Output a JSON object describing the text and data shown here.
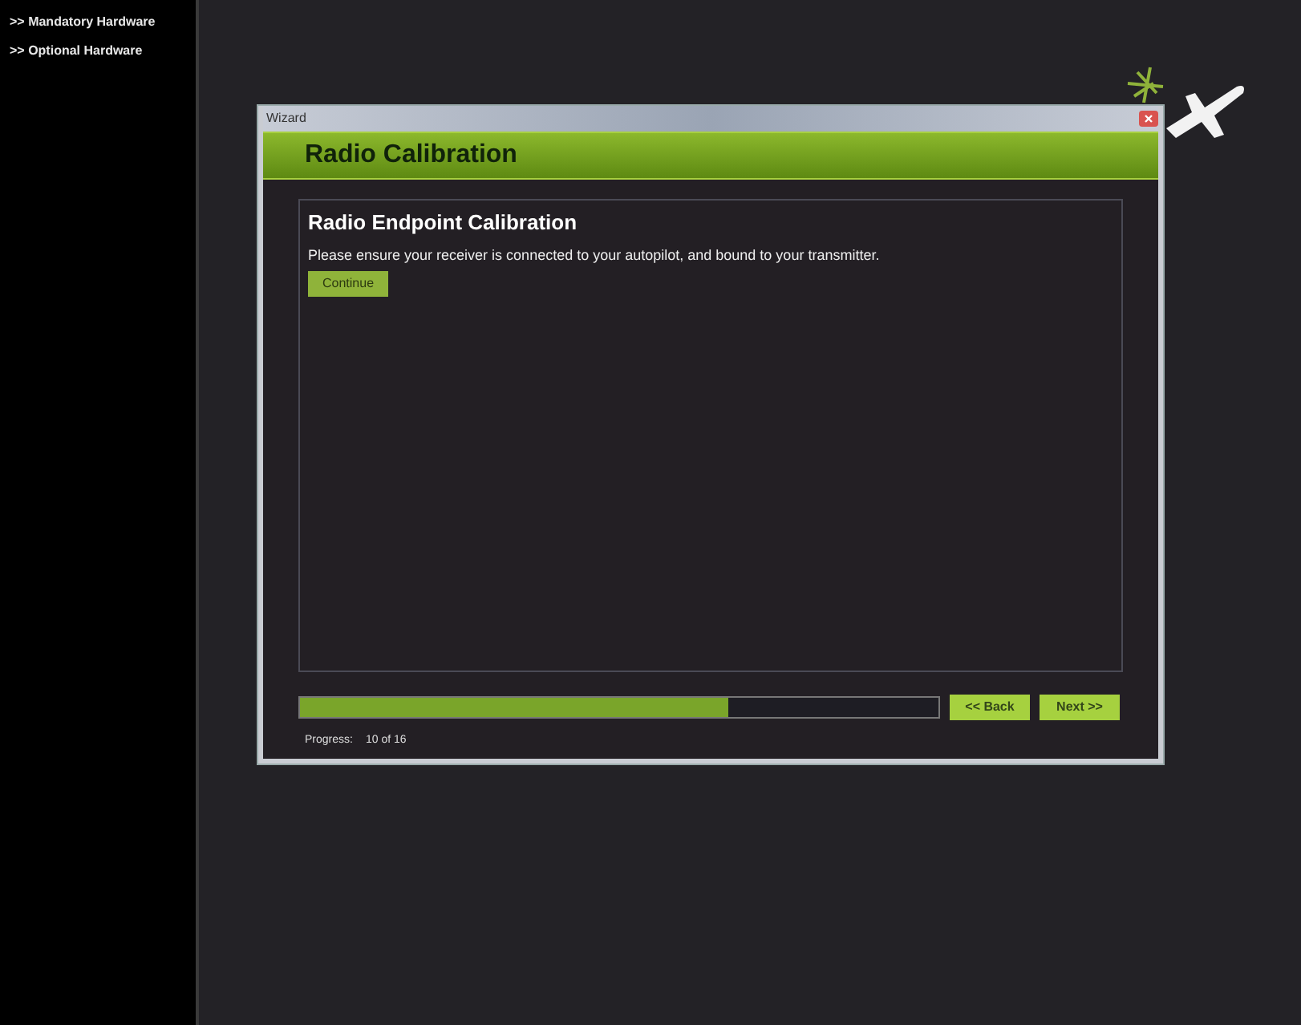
{
  "sidebar": {
    "items": [
      {
        "label": ">> Mandatory Hardware"
      },
      {
        "label": ">> Optional Hardware"
      }
    ]
  },
  "window": {
    "title": "Wizard"
  },
  "header": {
    "title": "Radio Calibration"
  },
  "panel": {
    "heading": "Radio Endpoint Calibration",
    "message": "Please ensure your receiver is connected to your autopilot, and bound to your transmitter.",
    "button": "Continue"
  },
  "progress": {
    "level": 0.67,
    "label": "Progress:",
    "count": "10 of 16"
  },
  "buttons": [
    {
      "label": "<< Back"
    },
    {
      "label": "Next >>"
    }
  ]
}
